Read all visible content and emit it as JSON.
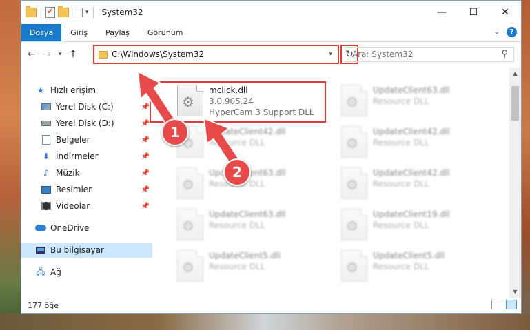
{
  "window": {
    "title": "System32",
    "controls": {
      "minimize": "—",
      "maximize": "☐",
      "close": "✕"
    }
  },
  "ribbon": {
    "tabs": [
      "Dosya",
      "Giriş",
      "Paylaş",
      "Görünüm"
    ],
    "expand_icon": "chevron-down-icon",
    "help_label": "?"
  },
  "address": {
    "path": "C:\\Windows\\System32",
    "search_placeholder": "Ara: System32"
  },
  "nav": {
    "items": [
      {
        "label": "Hızlı erişim",
        "icon": "star-icon",
        "pinned": false
      },
      {
        "label": "Yerel Disk (C:)",
        "icon": "drive-icon",
        "pinned": true
      },
      {
        "label": "Yerel Disk (D:)",
        "icon": "drive-icon",
        "pinned": true
      },
      {
        "label": "Belgeler",
        "icon": "documents-icon",
        "pinned": true
      },
      {
        "label": "İndirmeler",
        "icon": "download-icon",
        "pinned": true
      },
      {
        "label": "Müzik",
        "icon": "music-icon",
        "pinned": true
      },
      {
        "label": "Resimler",
        "icon": "pictures-icon",
        "pinned": true
      },
      {
        "label": "Videolar",
        "icon": "video-icon",
        "pinned": true
      },
      {
        "label": "OneDrive",
        "icon": "cloud-icon",
        "pinned": false
      },
      {
        "label": "Bu bilgisayar",
        "icon": "computer-icon",
        "pinned": false,
        "selected": true
      },
      {
        "label": "Ağ",
        "icon": "network-icon",
        "pinned": false
      }
    ]
  },
  "files": {
    "left": [
      {
        "name": "mclick.dll",
        "version": "3.0.905.24",
        "desc": "HyperCam 3 Support DLL",
        "highlighted": true
      },
      {
        "name": "UpdateClient42.dll",
        "desc": "Resource DLL"
      },
      {
        "name": "UpdateClient63.dll",
        "desc": "Resource DLL"
      },
      {
        "name": "UpdateClient63.dll",
        "desc": "Resource DLL"
      },
      {
        "name": "UpdateClient5.dll",
        "desc": "Resource DLL"
      }
    ],
    "right": [
      {
        "name": "UpdateClient63.dll",
        "desc": "Resource DLL"
      },
      {
        "name": "UpdateClient42.dll",
        "desc": "Resource DLL"
      },
      {
        "name": "UpdateClient42.dll",
        "desc": "Resource DLL"
      },
      {
        "name": "UpdateClient19.dll",
        "desc": "Resource DLL"
      },
      {
        "name": "UpdateClient5.dll",
        "desc": "Resource DLL"
      }
    ]
  },
  "status": {
    "count": "177 öğe"
  },
  "annotations": {
    "badge1": "1",
    "badge2": "2",
    "color": "#e84a4a"
  }
}
